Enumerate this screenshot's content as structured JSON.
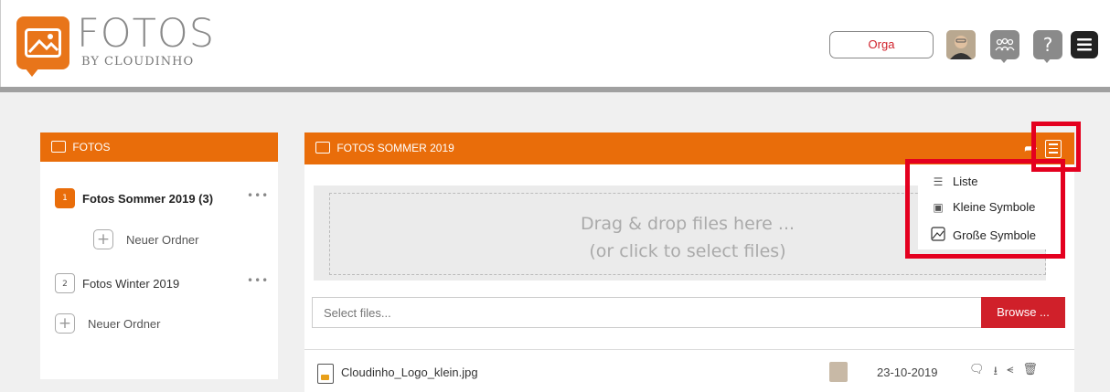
{
  "header": {
    "brand_title": "FOTOS",
    "brand_subtitle": "BY CLOUDINHO",
    "org_button": "Orga",
    "help_icon_glyph": "?"
  },
  "left_panel": {
    "title": "FOTOS",
    "folders": [
      {
        "number": "1",
        "name": "Fotos Sommer 2019 (3)",
        "more": "•••",
        "new_folder": "Neuer Ordner"
      },
      {
        "number": "2",
        "name": "Fotos Winter 2019",
        "more": "•••"
      }
    ],
    "new_folder_label": "Neuer Ordner"
  },
  "main_panel": {
    "title": "FOTOS SOMMER 2019",
    "dropzone_line1": "Drag & drop files here ...",
    "dropzone_line2": "(or click to select files)",
    "select_placeholder": "Select files...",
    "browse_label": "Browse ...",
    "files": [
      {
        "name": "Cloudinho_Logo_klein.jpg",
        "date": "23-10-2019"
      }
    ]
  },
  "view_menu": {
    "items": [
      {
        "label": "Liste",
        "icon": "list-icon"
      },
      {
        "label": "Kleine Symbole",
        "icon": "small-symbols-icon"
      },
      {
        "label": "Große Symbole",
        "icon": "large-symbols-icon"
      }
    ]
  },
  "colors": {
    "accent_orange": "#e96d0a",
    "browse_red": "#d0202a",
    "highlight_red": "#e4001f"
  }
}
